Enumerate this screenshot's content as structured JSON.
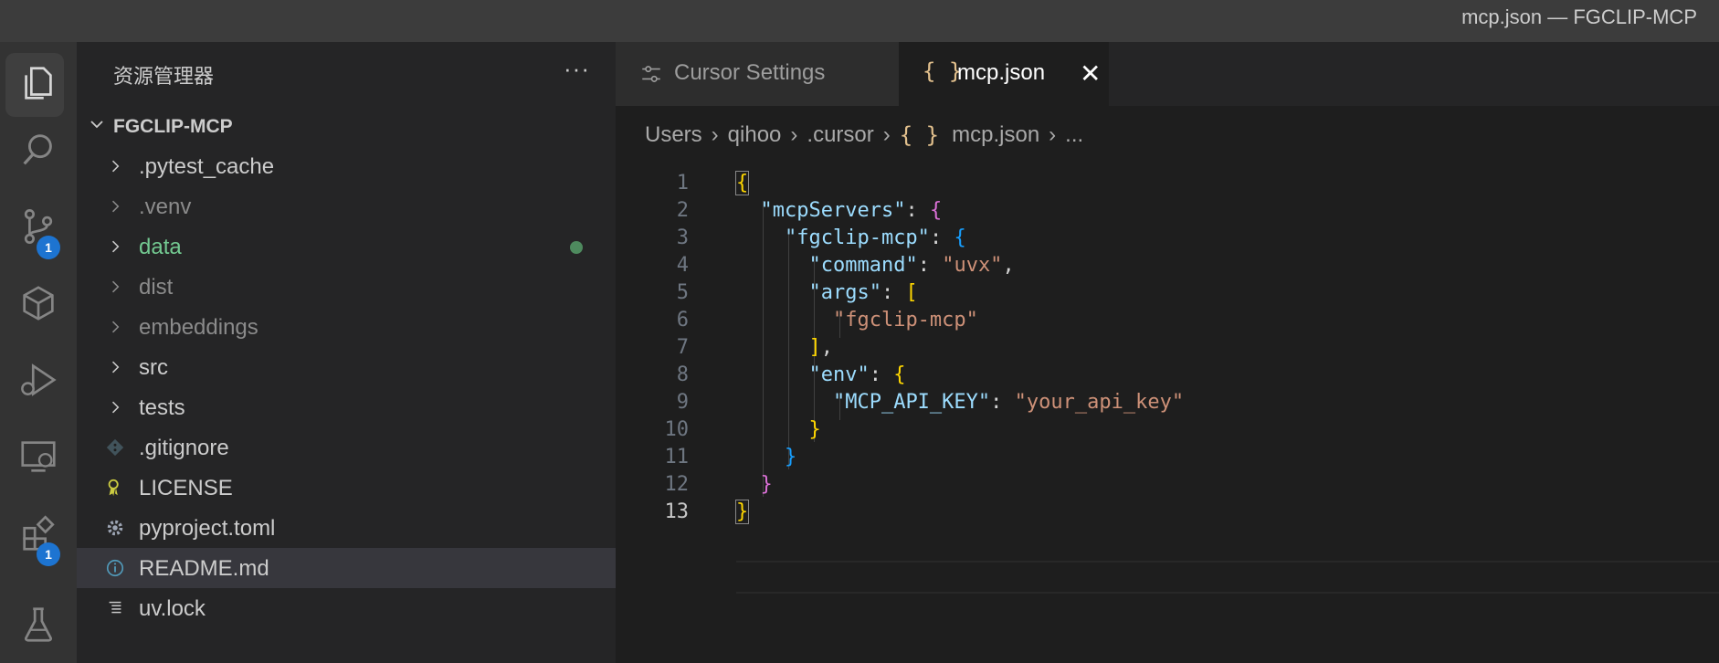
{
  "window": {
    "title": "mcp.json — FGCLIP-MCP"
  },
  "activity_bar": {
    "items": [
      {
        "name": "explorer-icon",
        "badge": ""
      },
      {
        "name": "search-icon",
        "badge": ""
      },
      {
        "name": "source-control-icon",
        "badge": "1"
      },
      {
        "name": "cube-icon",
        "badge": ""
      },
      {
        "name": "run-debug-icon",
        "badge": ""
      },
      {
        "name": "remote-explorer-icon",
        "badge": ""
      },
      {
        "name": "extensions-icon",
        "badge": "1"
      },
      {
        "name": "testing-icon",
        "badge": ""
      }
    ]
  },
  "sidebar": {
    "header": "资源管理器",
    "more": "···",
    "project": "FGCLIP-MCP",
    "items": [
      {
        "label": ".pytest_cache",
        "type": "folder"
      },
      {
        "label": ".venv",
        "type": "folder"
      },
      {
        "label": "data",
        "type": "folder"
      },
      {
        "label": "dist",
        "type": "folder"
      },
      {
        "label": "embeddings",
        "type": "folder"
      },
      {
        "label": "src",
        "type": "folder"
      },
      {
        "label": "tests",
        "type": "folder"
      },
      {
        "label": ".gitignore",
        "type": "file"
      },
      {
        "label": "LICENSE",
        "type": "file"
      },
      {
        "label": "pyproject.toml",
        "type": "file"
      },
      {
        "label": "README.md",
        "type": "file"
      },
      {
        "label": "uv.lock",
        "type": "file"
      }
    ]
  },
  "tabs": [
    {
      "label": "Cursor Settings",
      "active": false
    },
    {
      "label": "mcp.json",
      "active": true,
      "icon": "{ }",
      "close": "✕"
    }
  ],
  "breadcrumb": {
    "parts": [
      "Users",
      "qihoo",
      ".cursor",
      "mcp.json",
      "..."
    ],
    "icon": "{ }"
  },
  "editor": {
    "line_numbers": [
      "1",
      "2",
      "3",
      "4",
      "5",
      "6",
      "7",
      "8",
      "9",
      "10",
      "11",
      "12",
      "13"
    ],
    "tokens": {
      "l1_open": "{",
      "l2_key": "\"mcpServers\"",
      "colon": ": ",
      "l2_open": "{",
      "l3_key": "\"fgclip-mcp\"",
      "l3_open": "{",
      "l4_key": "\"command\"",
      "l4_val": "\"uvx\"",
      "comma": ",",
      "l5_key": "\"args\"",
      "l5_open": "[",
      "l6_val": "\"fgclip-mcp\"",
      "l7_close": "]",
      "l8_key": "\"env\"",
      "l8_open": "{",
      "l9_key": "\"MCP_API_KEY\"",
      "l9_val": "\"your_api_key\"",
      "l10_close": "}",
      "l11_close": "}",
      "l12_close": "}",
      "l13_close": "}"
    }
  },
  "colors": {
    "editor_bg": "#1e1e1e",
    "sidebar_bg": "#252526",
    "activity_bg": "#333333",
    "badge": "#1d74d1",
    "key": "#9cdcfe",
    "string": "#ce9178",
    "bracket_gold": "#ffd700",
    "bracket_orchid": "#da70d6",
    "bracket_blue": "#179fff",
    "git_added": "#73c991"
  }
}
